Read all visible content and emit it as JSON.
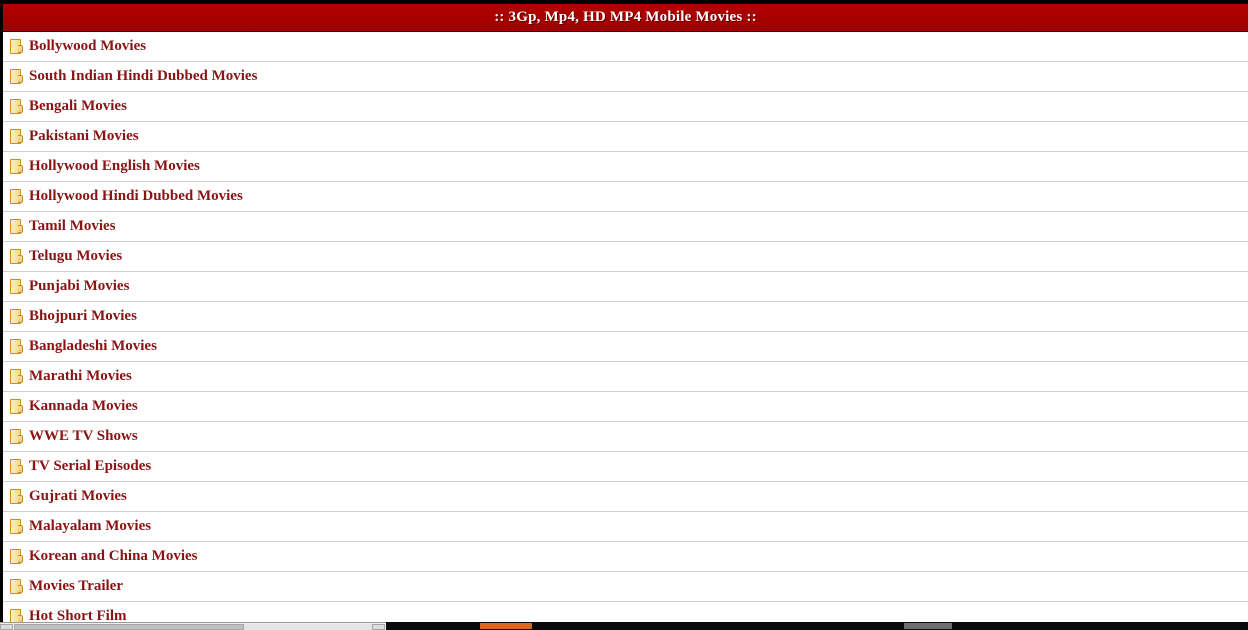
{
  "header": {
    "title": ":: 3Gp, Mp4, HD MP4 Mobile Movies ::",
    "background_color": "#ab0000",
    "text_color": "#ffffff"
  },
  "theme": {
    "link_color": "#8a1414",
    "separator_color": "#cfcfcf",
    "page_background": "#ffffff",
    "folder_icon_fill": "#f7e3a6",
    "folder_icon_border": "#d08c22"
  },
  "categories": [
    {
      "label": "Bollywood Movies",
      "icon": "folder-icon"
    },
    {
      "label": "South Indian Hindi Dubbed Movies",
      "icon": "folder-icon"
    },
    {
      "label": "Bengali Movies",
      "icon": "folder-icon"
    },
    {
      "label": "Pakistani Movies",
      "icon": "folder-icon"
    },
    {
      "label": "Hollywood English Movies",
      "icon": "folder-icon"
    },
    {
      "label": "Hollywood Hindi Dubbed Movies",
      "icon": "folder-icon"
    },
    {
      "label": "Tamil Movies",
      "icon": "folder-icon"
    },
    {
      "label": "Telugu Movies",
      "icon": "folder-icon"
    },
    {
      "label": "Punjabi Movies",
      "icon": "folder-icon"
    },
    {
      "label": "Bhojpuri Movies",
      "icon": "folder-icon"
    },
    {
      "label": "Bangladeshi Movies",
      "icon": "folder-icon"
    },
    {
      "label": "Marathi Movies",
      "icon": "folder-icon"
    },
    {
      "label": "Kannada Movies",
      "icon": "folder-icon"
    },
    {
      "label": "WWE TV Shows",
      "icon": "folder-icon"
    },
    {
      "label": "TV Serial Episodes",
      "icon": "folder-icon"
    },
    {
      "label": "Gujrati Movies",
      "icon": "folder-icon"
    },
    {
      "label": "Malayalam Movies",
      "icon": "folder-icon"
    },
    {
      "label": "Korean and China Movies",
      "icon": "folder-icon"
    },
    {
      "label": "Movies Trailer",
      "icon": "folder-icon"
    },
    {
      "label": "Hot Short Film",
      "icon": "folder-icon"
    }
  ],
  "chrome": {
    "scrollbar_thumb_color": "#bfbfbf",
    "taskbar_color": "#0a0a0a",
    "taskbar_accent_color": "#d2691e",
    "taskbar_gray_color": "#6e6e6e"
  }
}
